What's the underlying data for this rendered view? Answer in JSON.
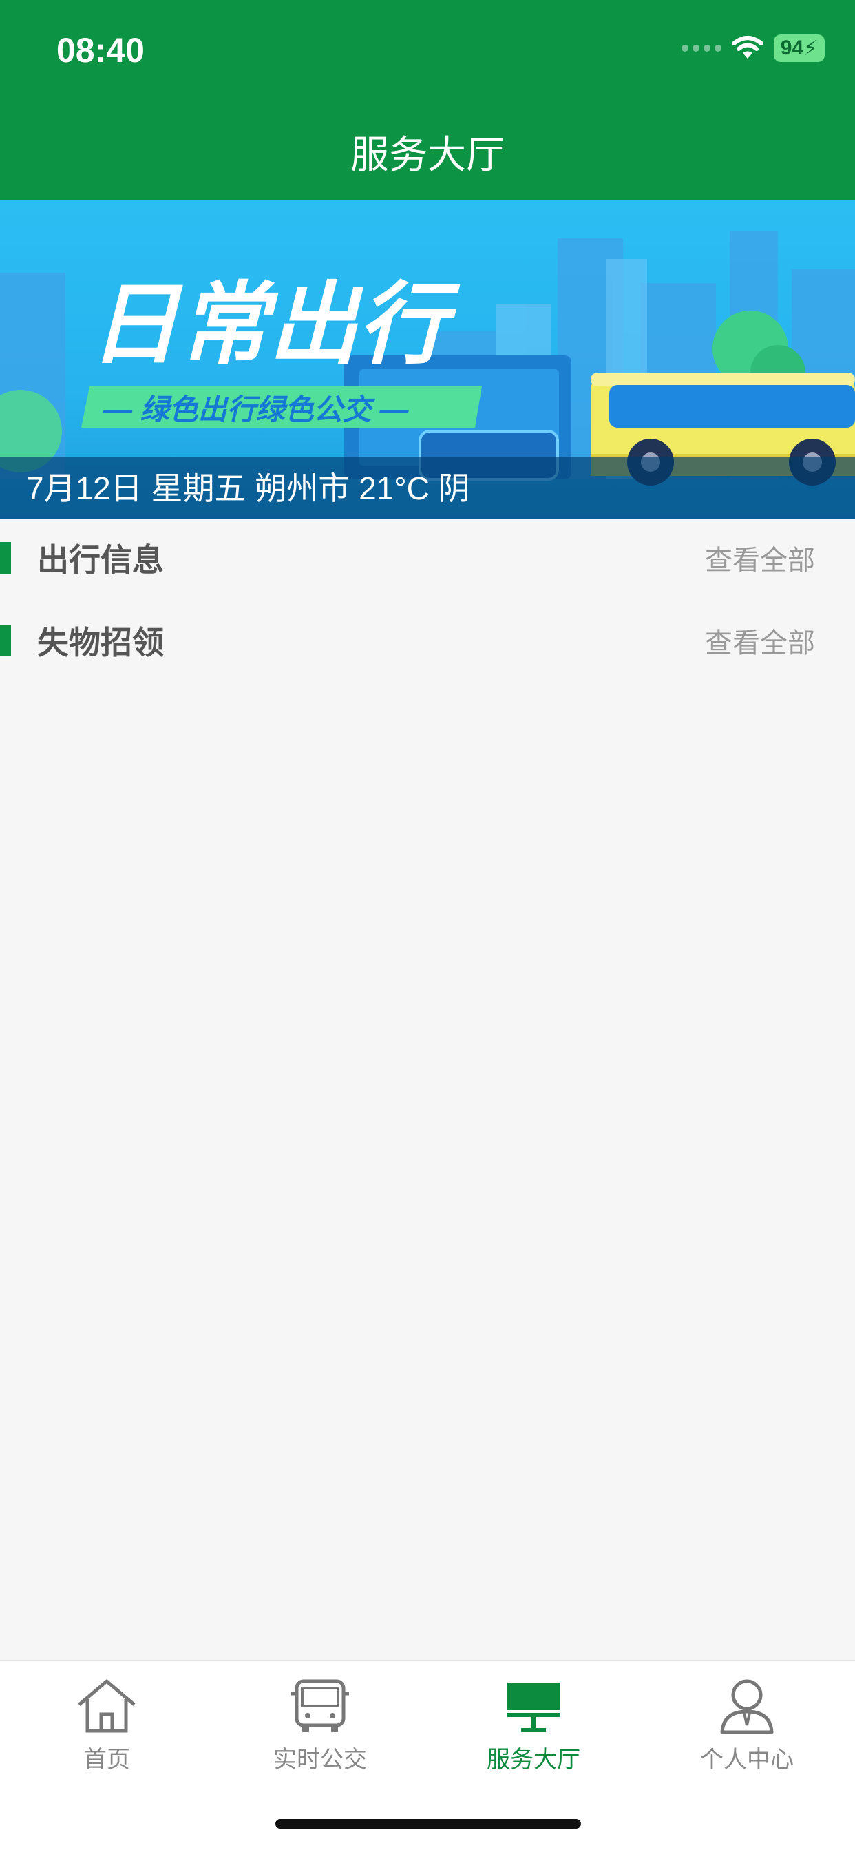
{
  "status_bar": {
    "time": "08:40",
    "battery": "94"
  },
  "header": {
    "title": "服务大厅"
  },
  "banner": {
    "headline": "日常出行",
    "slogan": "— 绿色出行绿色公交 —",
    "caption": "7月12日 星期五 朔州市 21°C 阴"
  },
  "sections": [
    {
      "title": "出行信息",
      "link": "查看全部"
    },
    {
      "title": "失物招领",
      "link": "查看全部"
    }
  ],
  "tabbar": {
    "items": [
      {
        "label": "首页",
        "icon": "home-icon"
      },
      {
        "label": "实时公交",
        "icon": "bus-icon"
      },
      {
        "label": "服务大厅",
        "icon": "service-hall-icon",
        "active": true
      },
      {
        "label": "个人中心",
        "icon": "person-icon"
      }
    ]
  },
  "colors": {
    "brand_green": "#0c9444",
    "banner_blue": "#27b3ee"
  }
}
